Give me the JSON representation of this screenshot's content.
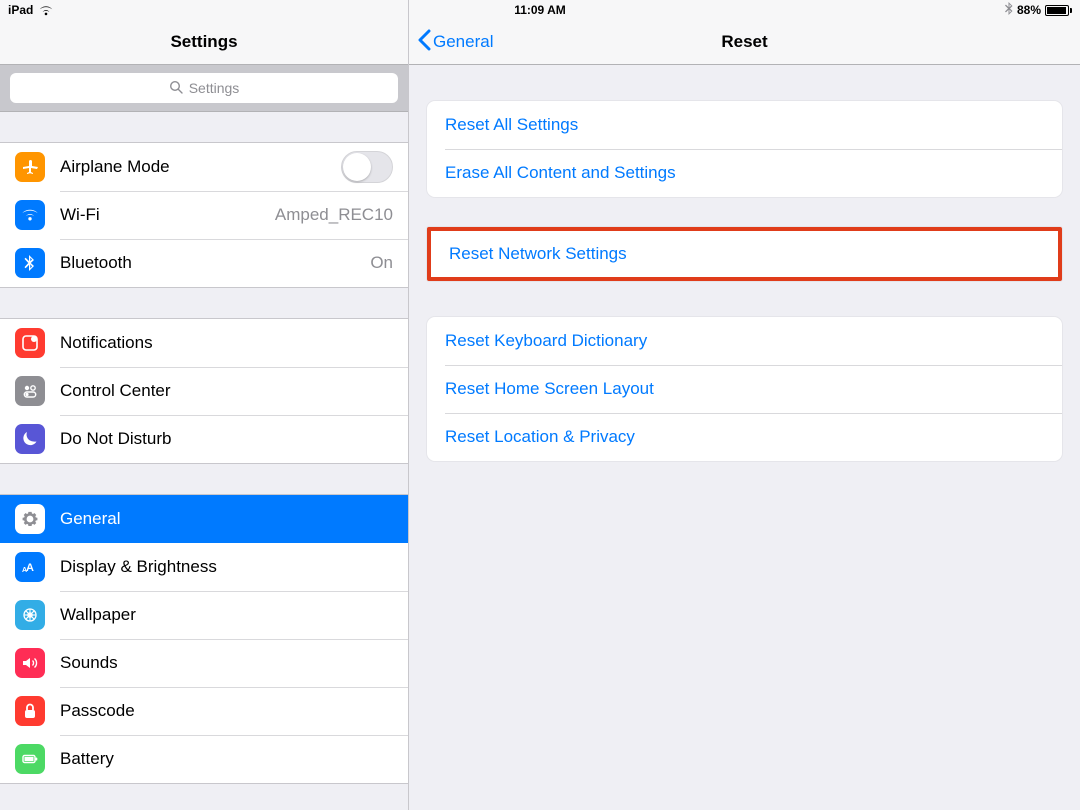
{
  "status": {
    "device": "iPad",
    "time": "11:09 AM",
    "battery_pct": "88%"
  },
  "sidebar": {
    "title": "Settings",
    "search_placeholder": "Settings",
    "groups": [
      {
        "rows": [
          {
            "id": "airplane",
            "label": "Airplane Mode",
            "icon": "airplane-icon",
            "iconClass": "ic-orange",
            "accessory": "switch",
            "switch_on": false
          },
          {
            "id": "wifi",
            "label": "Wi-Fi",
            "icon": "wifi-icon",
            "iconClass": "ic-blue",
            "accessory": "value",
            "value": "Amped_REC10"
          },
          {
            "id": "bluetooth",
            "label": "Bluetooth",
            "icon": "bluetooth-icon",
            "iconClass": "ic-blue",
            "accessory": "value",
            "value": "On"
          }
        ]
      },
      {
        "rows": [
          {
            "id": "notifications",
            "label": "Notifications",
            "icon": "notifications-icon",
            "iconClass": "ic-red"
          },
          {
            "id": "controlcenter",
            "label": "Control Center",
            "icon": "control-center-icon",
            "iconClass": "ic-gray"
          },
          {
            "id": "dnd",
            "label": "Do Not Disturb",
            "icon": "moon-icon",
            "iconClass": "ic-indigo"
          }
        ]
      },
      {
        "rows": [
          {
            "id": "general",
            "label": "General",
            "icon": "gear-icon",
            "iconClass": "ic-gray",
            "selected": true
          },
          {
            "id": "display",
            "label": "Display & Brightness",
            "icon": "display-icon",
            "iconClass": "ic-blue"
          },
          {
            "id": "wallpaper",
            "label": "Wallpaper",
            "icon": "wallpaper-icon",
            "iconClass": "ic-cyan"
          },
          {
            "id": "sounds",
            "label": "Sounds",
            "icon": "sounds-icon",
            "iconClass": "ic-pink"
          },
          {
            "id": "passcode",
            "label": "Passcode",
            "icon": "lock-icon",
            "iconClass": "ic-red"
          },
          {
            "id": "battery",
            "label": "Battery",
            "icon": "battery-icon",
            "iconClass": "ic-green"
          }
        ]
      }
    ]
  },
  "detail": {
    "back_label": "General",
    "title": "Reset",
    "groups": [
      {
        "rows": [
          {
            "id": "reset-all",
            "label": "Reset All Settings"
          },
          {
            "id": "erase-all",
            "label": "Erase All Content and Settings"
          }
        ]
      },
      {
        "highlight": true,
        "rows": [
          {
            "id": "reset-network",
            "label": "Reset Network Settings"
          }
        ]
      },
      {
        "rows": [
          {
            "id": "reset-keyboard",
            "label": "Reset Keyboard Dictionary"
          },
          {
            "id": "reset-home",
            "label": "Reset Home Screen Layout"
          },
          {
            "id": "reset-location",
            "label": "Reset Location & Privacy"
          }
        ]
      }
    ]
  },
  "colors": {
    "link": "#007aff",
    "highlight_border": "#e03c1a"
  }
}
